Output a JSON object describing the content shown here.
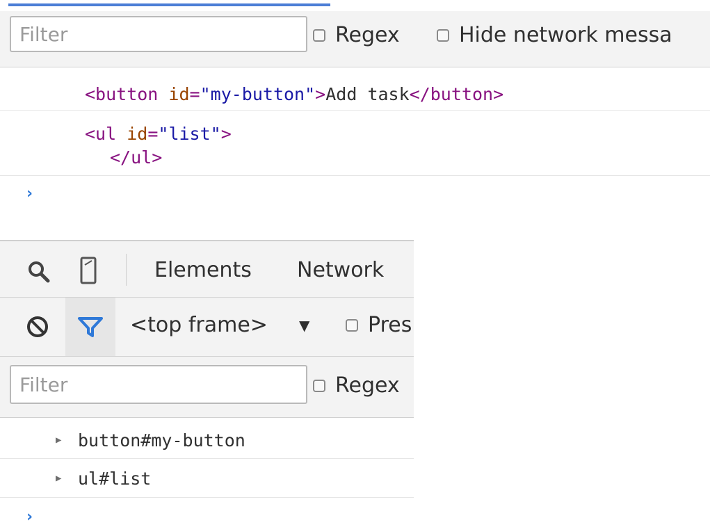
{
  "top_panel": {
    "filter_placeholder": "Filter",
    "regex_label": "Regex",
    "hide_network_label": "Hide network messa",
    "code": {
      "line1": {
        "tag_open": "<button ",
        "attr_name": "id",
        "equals": "=",
        "attr_value": "\"my-button\"",
        "close_bracket": ">",
        "text": "Add task",
        "tag_close": "</button>"
      },
      "line2": {
        "tag_open": "<ul ",
        "attr_name": "id",
        "equals": "=",
        "attr_value": "\"list\"",
        "close_bracket": ">"
      },
      "line3": {
        "tag_close": "</ul>"
      }
    },
    "prompt": "›"
  },
  "bottom_panel": {
    "tabs": [
      {
        "label": "Elements"
      },
      {
        "label": "Network"
      }
    ],
    "frame_select": "<top frame>",
    "frame_caret": "▼",
    "preserve_log_label": "Pres",
    "filter_placeholder": "Filter",
    "regex_label": "Regex",
    "tree_items": [
      {
        "label": "button#my-button"
      },
      {
        "label": "ul#list"
      }
    ],
    "prompt": "›"
  },
  "icons": {
    "search": "search-icon",
    "device": "device-mode-icon",
    "clear": "clear-console-icon",
    "filter": "filter-icon",
    "expand": "expand-triangle-icon"
  },
  "colors": {
    "accent": "#4c7ed6",
    "filter_icon": "#2f79d8",
    "tag": "#881280",
    "attribute": "#994500",
    "string": "#1a1aa6"
  }
}
